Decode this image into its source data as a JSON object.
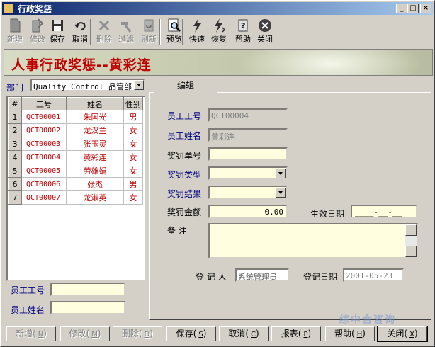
{
  "window": {
    "title": "行政奖惩"
  },
  "toolbar": [
    {
      "name": "new",
      "label": "新增",
      "disabled": true,
      "icon": "document-icon"
    },
    {
      "name": "edit",
      "label": "修改",
      "disabled": true,
      "icon": "edit-document-icon"
    },
    {
      "name": "save",
      "label": "保存",
      "disabled": false,
      "icon": "floppy-disk-icon"
    },
    {
      "name": "cancel",
      "label": "取消",
      "disabled": false,
      "icon": "undo-arrow-icon"
    },
    {
      "name": "delete",
      "label": "删除",
      "disabled": true,
      "icon": "cross-icon"
    },
    {
      "name": "filter",
      "label": "过滤",
      "disabled": true,
      "icon": "hammer-icon"
    },
    {
      "name": "refresh",
      "label": "刷新",
      "disabled": true,
      "icon": "refresh-icon"
    },
    {
      "name": "preview",
      "label": "预览",
      "disabled": false,
      "icon": "magnifier-doc-icon"
    },
    {
      "name": "quick",
      "label": "快速",
      "disabled": false,
      "icon": "lightning-icon"
    },
    {
      "name": "restore",
      "label": "恢复",
      "disabled": false,
      "icon": "lightning-restore-icon"
    },
    {
      "name": "help",
      "label": "帮助",
      "disabled": false,
      "icon": "help-book-icon"
    },
    {
      "name": "close",
      "label": "关闭",
      "disabled": false,
      "icon": "close-circle-icon"
    }
  ],
  "banner": {
    "title": "人事行政奖惩--黄彩连"
  },
  "department": {
    "label": "部门",
    "value": "Quality Control  品管部"
  },
  "grid": {
    "headers": [
      "#",
      "工号",
      "姓名",
      "性别"
    ],
    "rows": [
      {
        "n": "1",
        "id": "QCT00001",
        "name": "朱国光",
        "sex": "男"
      },
      {
        "n": "2",
        "id": "QCT00002",
        "name": "龙汉兰",
        "sex": "女"
      },
      {
        "n": "3",
        "id": "QCT00003",
        "name": "张玉灵",
        "sex": "女"
      },
      {
        "n": "4",
        "id": "QCT00004",
        "name": "黄彩连",
        "sex": "女"
      },
      {
        "n": "5",
        "id": "QCT00005",
        "name": "劳雄娟",
        "sex": "女"
      },
      {
        "n": "6",
        "id": "QCT00006",
        "name": "张杰",
        "sex": "男"
      },
      {
        "n": "7",
        "id": "QCT00007",
        "name": "龙淑英",
        "sex": "女"
      }
    ]
  },
  "search": {
    "emp_no_label": "员工工号",
    "emp_name_label": "员工姓名",
    "emp_no": "",
    "emp_name": ""
  },
  "tab": {
    "label": "编辑"
  },
  "form": {
    "emp_no_label": "员工工号",
    "emp_no": "QCT00004",
    "emp_name_label": "员工姓名",
    "emp_name": "黄彩连",
    "doc_no_label": "奖罚单号",
    "doc_no": "",
    "type_label": "奖罚类型",
    "type": "",
    "result_label": "奖罚结果",
    "result": "",
    "amount_label": "奖罚金额",
    "amount": "0.00",
    "effective_label": "生效日期",
    "effective": "____-__-__",
    "remark_label": "备    注",
    "remark": "",
    "registrar_label": "登 记 人",
    "registrar": "系统管理员",
    "reg_date_label": "登记日期",
    "reg_date": "2001-05-23"
  },
  "buttons": [
    {
      "name": "new",
      "label": "新增",
      "key": "N",
      "disabled": true
    },
    {
      "name": "edit",
      "label": "修改",
      "key": "M",
      "disabled": true
    },
    {
      "name": "delete",
      "label": "删除",
      "key": "D",
      "disabled": true
    },
    {
      "name": "save",
      "label": "保存",
      "key": "S",
      "disabled": false
    },
    {
      "name": "cancel",
      "label": "取消",
      "key": "C",
      "disabled": false
    },
    {
      "name": "report",
      "label": "报表",
      "key": "P",
      "disabled": false
    },
    {
      "name": "help",
      "label": "帮助",
      "key": "H",
      "disabled": false
    },
    {
      "name": "close",
      "label": "关闭",
      "key": "X",
      "disabled": false
    }
  ],
  "watermark": "综中合咨询"
}
